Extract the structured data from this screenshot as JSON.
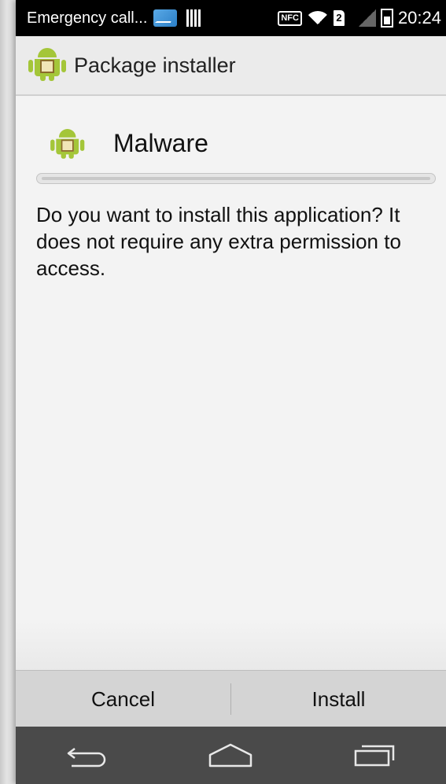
{
  "status_bar": {
    "carrier_text": "Emergency call...",
    "nfc_label": "NFC",
    "sim_label": "2",
    "time": "20:24"
  },
  "action_bar": {
    "title": "Package installer"
  },
  "app": {
    "name": "Malware",
    "message": "Do you want to install this application? It does not require any extra permission to access."
  },
  "buttons": {
    "cancel_label": "Cancel",
    "install_label": "Install"
  },
  "navigation": {
    "back_icon": "back-icon",
    "home_icon": "home-icon",
    "recent_apps_icon": "recent-apps-icon"
  },
  "colors": {
    "status_bar": "#000000",
    "action_bar": "#ebebeb",
    "background": "#f3f3f3",
    "button_bar": "#d4d4d4",
    "nav_bar": "#4a4a4a",
    "android_green": "#a4c639"
  }
}
